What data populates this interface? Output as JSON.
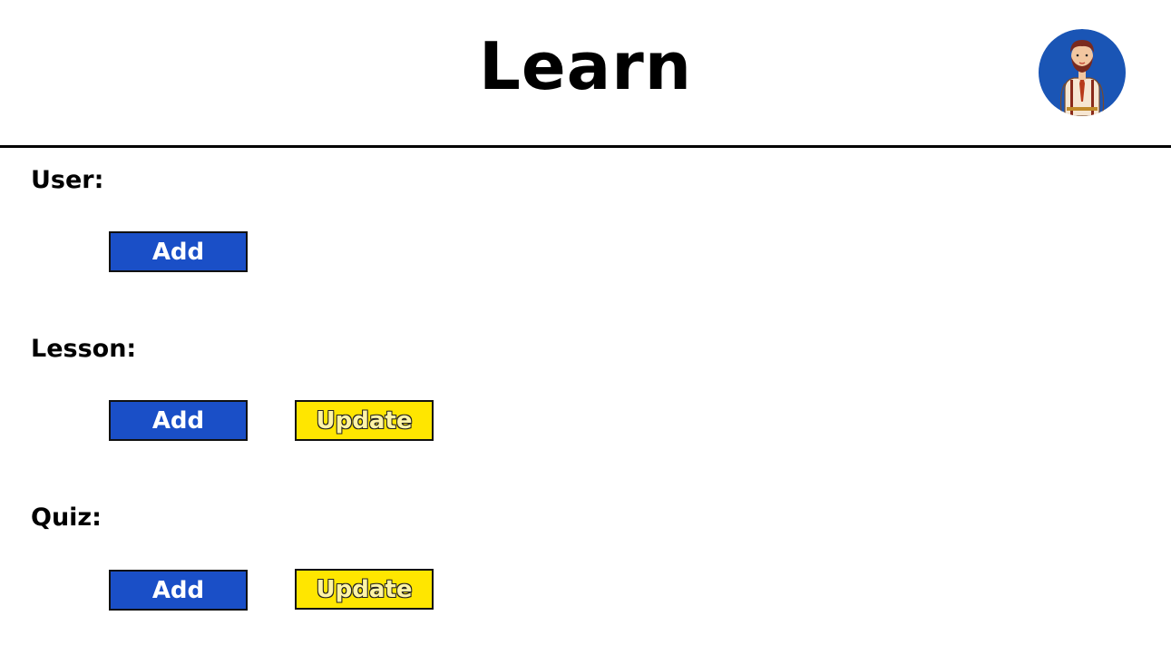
{
  "header": {
    "title": "Learn",
    "avatar_icon": "user-avatar-icon"
  },
  "sections": [
    {
      "label": "User:",
      "buttons": {
        "add": "Add"
      }
    },
    {
      "label": "Lesson:",
      "buttons": {
        "add": "Add",
        "update": "Update"
      }
    },
    {
      "label": "Quiz:",
      "buttons": {
        "add": "Add",
        "update": "Update"
      }
    }
  ],
  "colors": {
    "add_button": "#1a4fc7",
    "update_button": "#ffe600",
    "avatar_background": "#1a55b5"
  }
}
